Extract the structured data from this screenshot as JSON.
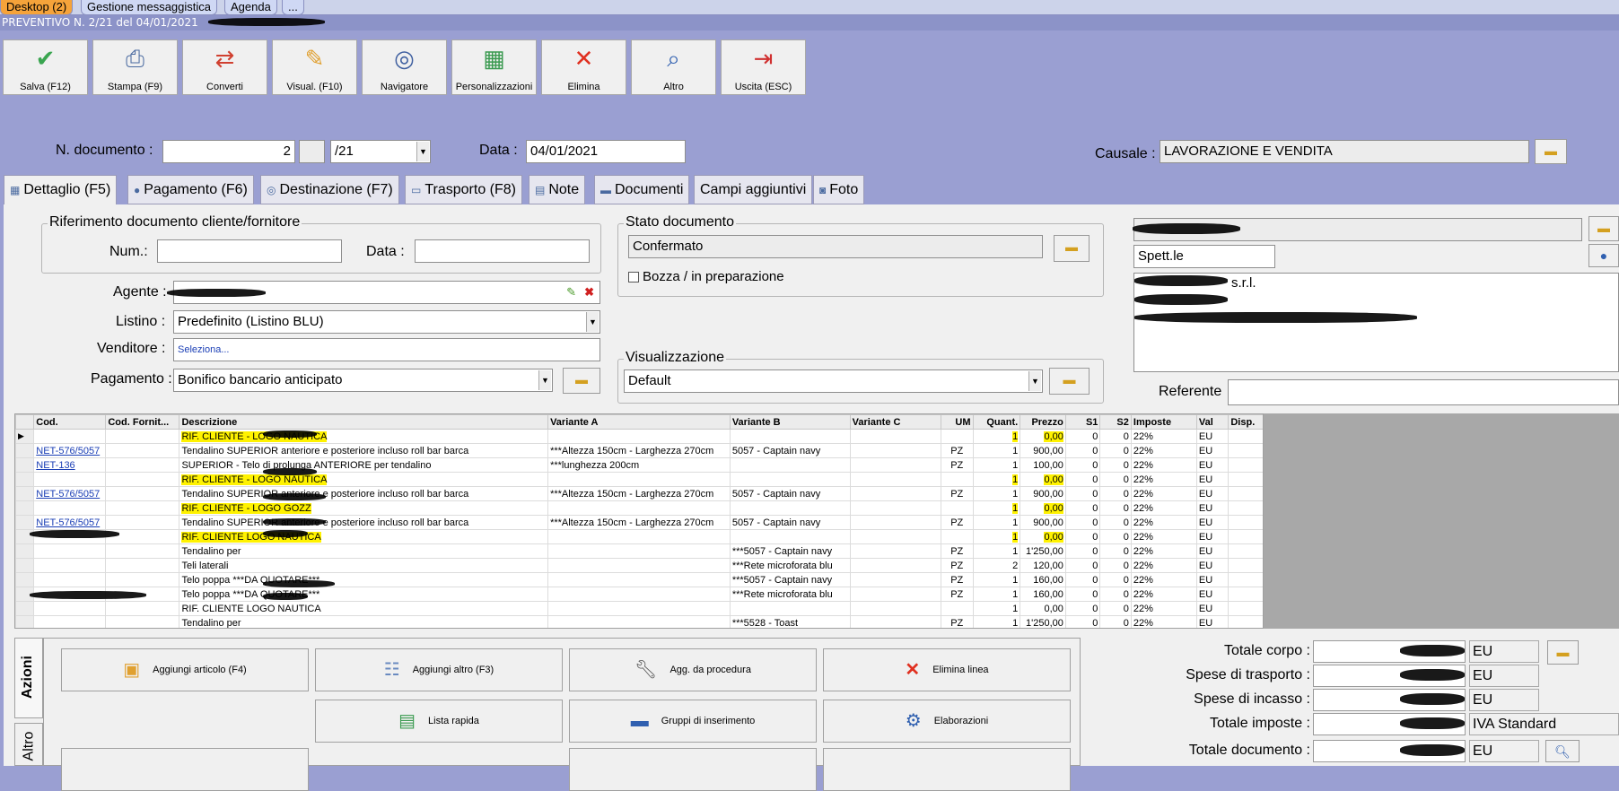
{
  "tabs_top": [
    "Desktop (2)",
    "Gestione messaggistica",
    "Agenda",
    "..."
  ],
  "doc_title": "PREVENTIVO N. 2/21 del 04/01/2021",
  "toolbar": [
    {
      "label": "Salva (F12)",
      "icon": "check-circle-icon",
      "color": "#3aa550"
    },
    {
      "label": "Stampa (F9)",
      "icon": "printer-icon",
      "color": "#4a6aa0"
    },
    {
      "label": "Converti",
      "icon": "convert-icon",
      "color": "#d04030"
    },
    {
      "label": "Visual. (F10)",
      "icon": "magic-wand-icon",
      "color": "#e0a030"
    },
    {
      "label": "Navigatore",
      "icon": "compass-icon",
      "color": "#4060a0"
    },
    {
      "label": "Personalizzazioni",
      "icon": "grid-blocks-icon",
      "color": "#3a9a50"
    },
    {
      "label": "Elimina",
      "icon": "x-icon",
      "color": "#e03020"
    },
    {
      "label": "Altro",
      "icon": "magnifier-icon",
      "color": "#3060b0"
    },
    {
      "label": "Uscita (ESC)",
      "icon": "exit-door-icon",
      "color": "#d03030"
    }
  ],
  "header": {
    "ndoc_label": "N. documento :",
    "ndoc_value": "2",
    "ndoc_suffix": "/21",
    "data_label": "Data :",
    "data_value": "04/01/2021",
    "causale_label": "Causale :",
    "causale_value": "LAVORAZIONE E VENDITA"
  },
  "main_tabs": [
    "Dettaglio (F5)",
    "Pagamento (F6)",
    "Destinazione (F7)",
    "Trasporto (F8)",
    "Note",
    "Documenti",
    "Campi aggiuntivi",
    "Foto"
  ],
  "rif": {
    "title": "Riferimento documento cliente/fornitore",
    "num_label": "Num.:",
    "data_label": "Data :"
  },
  "stato": {
    "title": "Stato documento",
    "value": "Confermato",
    "bozza": "Bozza / in preparazione"
  },
  "left_fields": {
    "agente_label": "Agente :",
    "listino_label": "Listino :",
    "listino_value": "Predefinito (Listino BLU)",
    "venditore_label": "Venditore :",
    "venditore_value": "Seleziona...",
    "pagamento_label": "Pagamento :",
    "pagamento_value": "Bonifico bancario anticipato"
  },
  "visual": {
    "title": "Visualizzazione",
    "value": "Default"
  },
  "addr": {
    "spett": "Spett.le",
    "line1": "s.r.l.",
    "referente_label": "Referente"
  },
  "grid": {
    "columns": [
      "Cod.",
      "Cod. Fornit...",
      "Descrizione",
      "Variante A",
      "Variante B",
      "Variante C",
      "UM",
      "Quant.",
      "Prezzo",
      "S1",
      "S2",
      "Imposte",
      "Val",
      "Disp."
    ],
    "rows": [
      {
        "cod": "",
        "desc": "RIF. CLIENTE   - LOGO NAUTICA",
        "va": "",
        "vb": "",
        "um": "",
        "q": "1",
        "p": "0,00",
        "s1": "0",
        "s2": "0",
        "imp": "22%",
        "val": "EU",
        "hl": true
      },
      {
        "cod": "NET-576/5057",
        "desc": "Tendalino SUPERIOR anteriore e posteriore incluso roll bar barca",
        "va": "***Altezza 150cm - Larghezza 270cm",
        "vb": "5057 - Captain navy",
        "um": "PZ",
        "q": "1",
        "p": "900,00",
        "s1": "0",
        "s2": "0",
        "imp": "22%",
        "val": "EU",
        "hl": false
      },
      {
        "cod": "NET-136",
        "desc": "SUPERIOR - Telo di prolunga ANTERIORE per tendalino",
        "va": "***lunghezza 200cm",
        "vb": "",
        "um": "PZ",
        "q": "1",
        "p": "100,00",
        "s1": "0",
        "s2": "0",
        "imp": "22%",
        "val": "EU",
        "hl": false
      },
      {
        "cod": "",
        "desc": "RIF. CLIENTE   - LOGO NAUTICA",
        "va": "",
        "vb": "",
        "um": "",
        "q": "1",
        "p": "0,00",
        "s1": "0",
        "s2": "0",
        "imp": "22%",
        "val": "EU",
        "hl": true
      },
      {
        "cod": "NET-576/5057",
        "desc": "Tendalino SUPERIOR anteriore e posteriore incluso roll bar barca",
        "va": "***Altezza 150cm - Larghezza 270cm",
        "vb": "5057 - Captain navy",
        "um": "PZ",
        "q": "1",
        "p": "900,00",
        "s1": "0",
        "s2": "0",
        "imp": "22%",
        "val": "EU",
        "hl": false
      },
      {
        "cod": "",
        "desc": "RIF. CLIENTE   - LOGO GOZZ",
        "va": "",
        "vb": "",
        "um": "",
        "q": "1",
        "p": "0,00",
        "s1": "0",
        "s2": "0",
        "imp": "22%",
        "val": "EU",
        "hl": true
      },
      {
        "cod": "NET-576/5057",
        "desc": "Tendalino SUPERIOR anteriore e posteriore incluso roll bar barca",
        "va": "***Altezza 150cm - Larghezza 270cm",
        "vb": "5057 - Captain navy",
        "um": "PZ",
        "q": "1",
        "p": "900,00",
        "s1": "0",
        "s2": "0",
        "imp": "22%",
        "val": "EU",
        "hl": false
      },
      {
        "cod": "",
        "desc": "RIF. CLIENTE   LOGO NAUTICA",
        "va": "",
        "vb": "",
        "um": "",
        "q": "1",
        "p": "0,00",
        "s1": "0",
        "s2": "0",
        "imp": "22%",
        "val": "EU",
        "hl": true
      },
      {
        "cod": "",
        "desc": "Tendalino per",
        "va": "",
        "vb": "***5057 - Captain navy",
        "um": "PZ",
        "q": "1",
        "p": "1'250,00",
        "s1": "0",
        "s2": "0",
        "imp": "22%",
        "val": "EU",
        "hl": false
      },
      {
        "cod": "",
        "desc": "Teli laterali",
        "va": "",
        "vb": "***Rete microforata blu",
        "um": "PZ",
        "q": "2",
        "p": "120,00",
        "s1": "0",
        "s2": "0",
        "imp": "22%",
        "val": "EU",
        "hl": false
      },
      {
        "cod": "",
        "desc": "Telo poppa ***DA QUOTARE***",
        "va": "",
        "vb": "***5057 - Captain navy",
        "um": "PZ",
        "q": "1",
        "p": "160,00",
        "s1": "0",
        "s2": "0",
        "imp": "22%",
        "val": "EU",
        "hl": false
      },
      {
        "cod": "",
        "desc": "Telo poppa ***DA QUOTARE***",
        "va": "",
        "vb": "***Rete microforata blu",
        "um": "PZ",
        "q": "1",
        "p": "160,00",
        "s1": "0",
        "s2": "0",
        "imp": "22%",
        "val": "EU",
        "hl": false
      },
      {
        "cod": "",
        "desc": "RIF. CLIENTE   LOGO NAUTICA",
        "va": "",
        "vb": "",
        "um": "",
        "q": "1",
        "p": "0,00",
        "s1": "0",
        "s2": "0",
        "imp": "22%",
        "val": "EU",
        "hl": false
      },
      {
        "cod": "",
        "desc": "Tendalino per",
        "va": "",
        "vb": "***5528 - Toast",
        "um": "PZ",
        "q": "1",
        "p": "1'250,00",
        "s1": "0",
        "s2": "0",
        "imp": "22%",
        "val": "EU",
        "hl": false
      }
    ]
  },
  "actions": {
    "vtab1": "Azioni",
    "vtab2": "Altro",
    "buttons": [
      "Aggiungi articolo (F4)",
      "Aggiungi altro (F3)",
      "Agg. da procedura",
      "Elimina linea",
      "Lista rapida",
      "Gruppi di inserimento",
      "Elaborazioni"
    ]
  },
  "totals": [
    {
      "label": "Totale corpo :",
      "curr": "EU"
    },
    {
      "label": "Spese di trasporto :",
      "curr": "EU"
    },
    {
      "label": "Spese di incasso :",
      "curr": "EU"
    },
    {
      "label": "Totale imposte :",
      "curr": "IVA Standard"
    },
    {
      "label": "Totale documento :",
      "curr": "EU"
    }
  ]
}
